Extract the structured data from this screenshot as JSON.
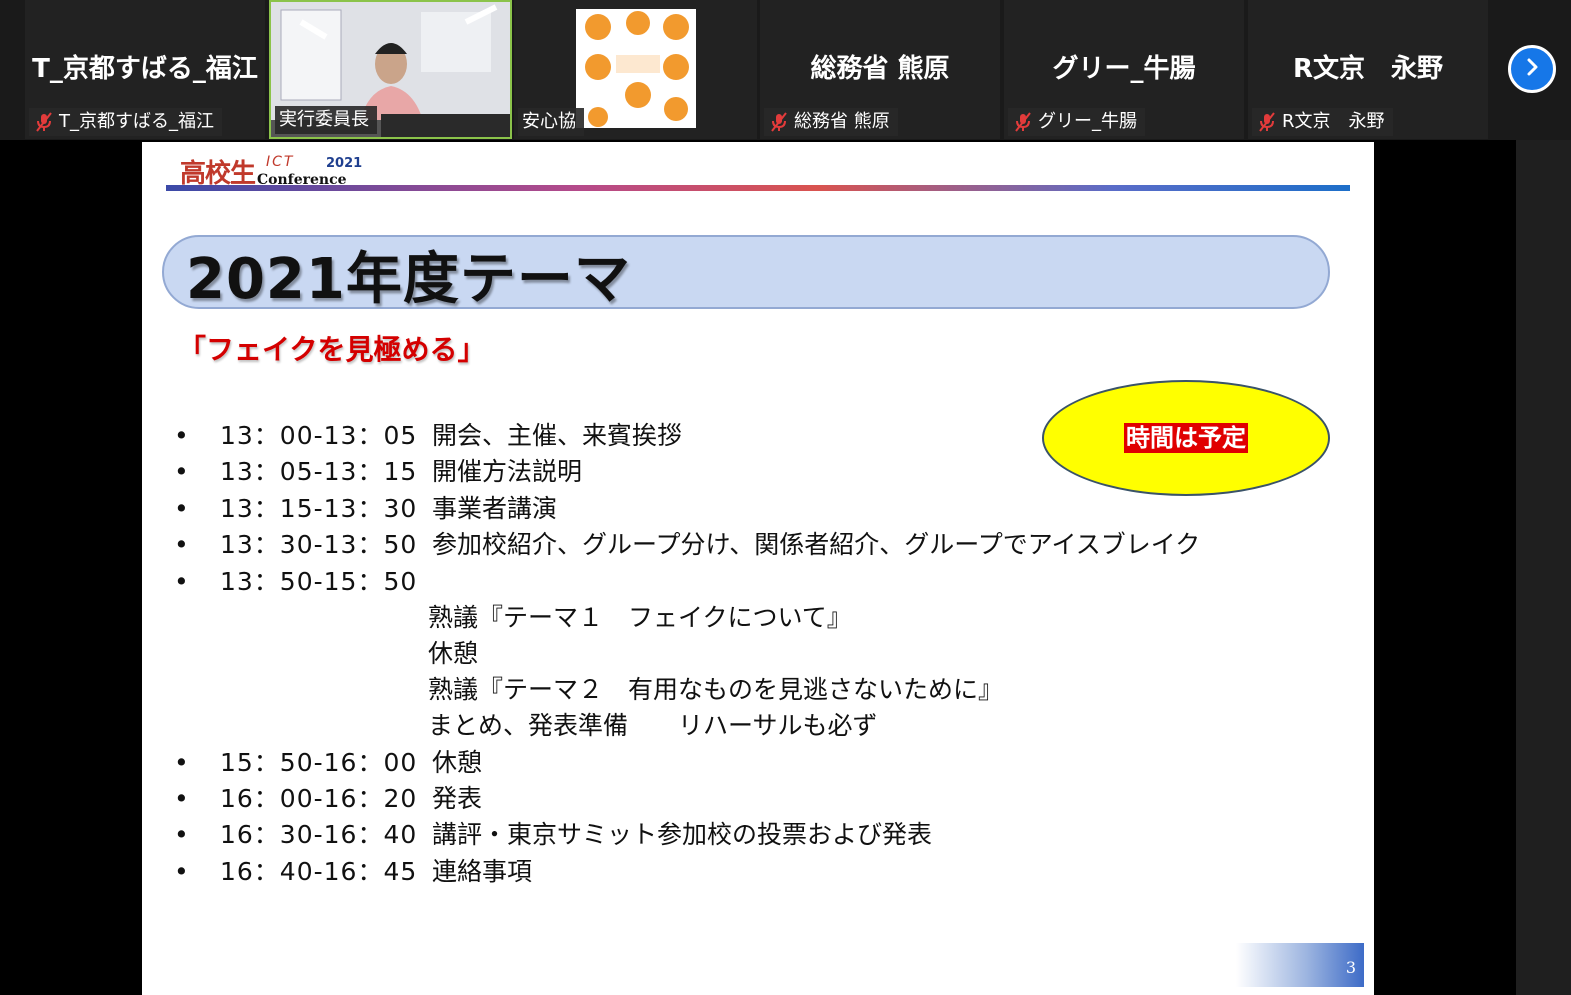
{
  "participants": [
    {
      "big_name": "T_京都すばる_福江",
      "label": "T_京都すばる_福江",
      "muted": true,
      "video": false
    },
    {
      "big_name": "",
      "label": "実行委員長",
      "muted": false,
      "video": true,
      "active_speaker": true
    },
    {
      "big_name": "",
      "label": "安心協",
      "muted": false,
      "video": false,
      "logo": true
    },
    {
      "big_name": "総務省 熊原",
      "label": "総務省 熊原",
      "muted": true,
      "video": false
    },
    {
      "big_name": "グリー_牛腸",
      "label": "グリー_牛腸",
      "muted": true,
      "video": false
    },
    {
      "big_name": "R文京　永野",
      "label": "R文京　永野",
      "muted": true,
      "video": false
    }
  ],
  "icons": {
    "mic": "mic-off-icon",
    "next": "chevron-right-icon"
  },
  "colors": {
    "accent_blue": "#1677e8",
    "mic_off_red": "#e23b3b",
    "title_red": "#d40000",
    "bubble_yellow": "#ffff00",
    "pill_blue": "#c9d8f2"
  },
  "slide": {
    "logo": {
      "kanji": "高校生",
      "ict": "ICT",
      "year": "2021",
      "conference": "Conference"
    },
    "title": "2021年度テーマ",
    "subtitle": "「フェイクを見極める」",
    "note": "時間は予定",
    "agenda": [
      {
        "bullet": "•",
        "time": "13：00-13：05",
        "desc": "開会、主催、来賓挨拶"
      },
      {
        "bullet": "•",
        "time": "13：05-13：15",
        "desc": "開催方法説明"
      },
      {
        "bullet": "•",
        "time": "13：15-13：30",
        "desc": "事業者講演"
      },
      {
        "bullet": "•",
        "time": "13：30-13：50",
        "desc": "参加校紹介、グループ分け、関係者紹介、グループでアイスブレイク"
      },
      {
        "bullet": "•",
        "time": "13：50-15：50",
        "desc": ""
      },
      {
        "bullet": "•",
        "time": "15：50-16：00",
        "desc": "休憩"
      },
      {
        "bullet": "•",
        "time": "16：00-16：20",
        "desc": "発表"
      },
      {
        "bullet": "•",
        "time": "16：30-16：40",
        "desc": "講評・東京サミット参加校の投票および発表"
      },
      {
        "bullet": "•",
        "time": "16：40-16：45",
        "desc": "連絡事項"
      }
    ],
    "sub_items": [
      "熟議『テーマ１　フェイクについて』",
      "休憩",
      "熟議『テーマ２　有用なものを見逃さないために』",
      "まとめ、発表準備　　リハーサルも必ず"
    ],
    "page_number": "3"
  }
}
